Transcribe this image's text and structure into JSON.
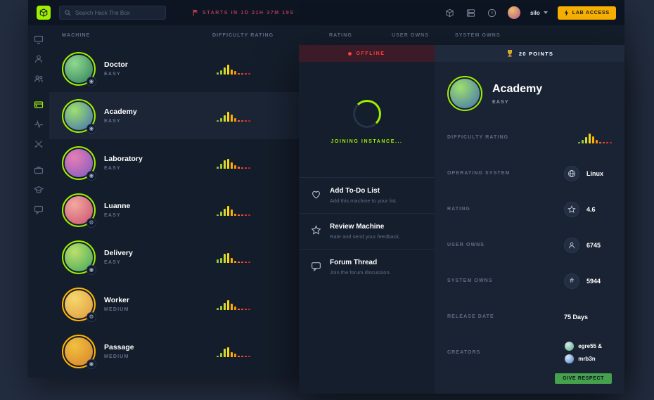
{
  "colors": {
    "easy": "#9fef00",
    "medium": "#ffb500",
    "accent_green": "#9fef00",
    "offline_red": "#ff3e3e",
    "lab_yellow": "#f7af00"
  },
  "spark_colors": [
    "#8bc34a",
    "#9ccc2e",
    "#cddc39",
    "#ffd600",
    "#ffb300",
    "#ff8f00",
    "#ff7043",
    "#f4511e",
    "#e53935",
    "#c62828"
  ],
  "topbar": {
    "search_placeholder": "Search Hack The Box",
    "countdown": "STARTS IN 1D 21H 37M 19S",
    "username": "silo",
    "lab_access_label": "LAB ACCESS",
    "icons": [
      "box-icon",
      "servers-icon",
      "help-icon"
    ]
  },
  "sidebar": {
    "items": [
      "dashboard",
      "profile",
      "teams",
      "machines",
      "tracks",
      "battlegrounds",
      "jobs",
      "academy",
      "forum"
    ],
    "active": "machines"
  },
  "table": {
    "headers": [
      "MACHINE",
      "DIFFICULTY RATING",
      "RATING",
      "USER OWNS",
      "SYSTEM OWNS"
    ],
    "rows": [
      {
        "name": "Doctor",
        "difficulty": "EASY",
        "selected": false,
        "badge": "◉",
        "avatar_colors": [
          "#2e7d5b",
          "#8fd98f"
        ],
        "spark": [
          2,
          4,
          7,
          10,
          5,
          3,
          1,
          1,
          1,
          1
        ]
      },
      {
        "name": "Academy",
        "difficulty": "EASY",
        "selected": true,
        "badge": "◉",
        "avatar_colors": [
          "#3f6fb5",
          "#9fe06c"
        ],
        "spark": [
          1,
          3,
          6,
          10,
          7,
          3,
          1,
          1,
          1,
          1
        ]
      },
      {
        "name": "Laboratory",
        "difficulty": "EASY",
        "selected": false,
        "badge": "◉",
        "avatar_colors": [
          "#7e57c2",
          "#e57fb3"
        ],
        "spark": [
          2,
          5,
          8,
          10,
          6,
          3,
          2,
          1,
          1,
          1
        ]
      },
      {
        "name": "Luanne",
        "difficulty": "EASY",
        "selected": false,
        "badge": "⚙",
        "avatar_colors": [
          "#c94f6d",
          "#f2a9a0"
        ],
        "spark": [
          1,
          4,
          7,
          10,
          6,
          2,
          1,
          1,
          1,
          1
        ]
      },
      {
        "name": "Delivery",
        "difficulty": "EASY",
        "selected": false,
        "badge": "◉",
        "avatar_colors": [
          "#3fa65c",
          "#bde06a"
        ],
        "spark": [
          3,
          5,
          9,
          10,
          5,
          2,
          1,
          1,
          1,
          1
        ]
      },
      {
        "name": "Worker",
        "difficulty": "MEDIUM",
        "selected": false,
        "badge": "⚙",
        "avatar_colors": [
          "#e09b3d",
          "#f5d76e"
        ],
        "spark": [
          2,
          4,
          7,
          10,
          6,
          3,
          1,
          1,
          1,
          1
        ]
      },
      {
        "name": "Passage",
        "difficulty": "MEDIUM",
        "selected": false,
        "badge": "◉",
        "avatar_colors": [
          "#d9822b",
          "#f0c040"
        ],
        "spark": [
          1,
          4,
          8,
          10,
          5,
          3,
          1,
          1,
          1,
          1
        ]
      }
    ]
  },
  "modal": {
    "status": "OFFLINE",
    "points": "20 POINTS",
    "joining": "JOINING INSTANCE...",
    "actions": [
      {
        "icon": "heart-icon",
        "title": "Add To-Do List",
        "subtitle": "Add this machine to your list."
      },
      {
        "icon": "star-icon",
        "title": "Review Machine",
        "subtitle": "Rate and send your feedback."
      },
      {
        "icon": "chat-icon",
        "title": "Forum Thread",
        "subtitle": "Join the forum discussion."
      }
    ],
    "detail": {
      "title": "Academy",
      "difficulty": "EASY",
      "avatar_colors": [
        "#3f6fb5",
        "#9fe06c"
      ],
      "spark": [
        1,
        3,
        6,
        10,
        7,
        3,
        1,
        1,
        1,
        1
      ],
      "rows": {
        "diff": {
          "label": "DIFFICULTY RATING"
        },
        "os": {
          "label": "OPERATING SYSTEM",
          "value": "Linux",
          "icon": "globe-icon"
        },
        "rating": {
          "label": "RATING",
          "value": "4.6",
          "icon": "star-icon"
        },
        "user_owns": {
          "label": "USER OWNS",
          "value": "6745",
          "icon": "user-icon"
        },
        "system_owns": {
          "label": "SYSTEM OWNS",
          "value": "5944",
          "icon": "hash-icon"
        },
        "release": {
          "label": "RELEASE DATE",
          "value": "75 Days"
        },
        "creators": {
          "label": "CREATORS",
          "names": [
            "egre55 &",
            "mrb3n"
          ],
          "avatar_colors": [
            "#4caf7d",
            "#4a7fd0"
          ]
        }
      },
      "respect_label": "GIVE RESPECT"
    }
  }
}
